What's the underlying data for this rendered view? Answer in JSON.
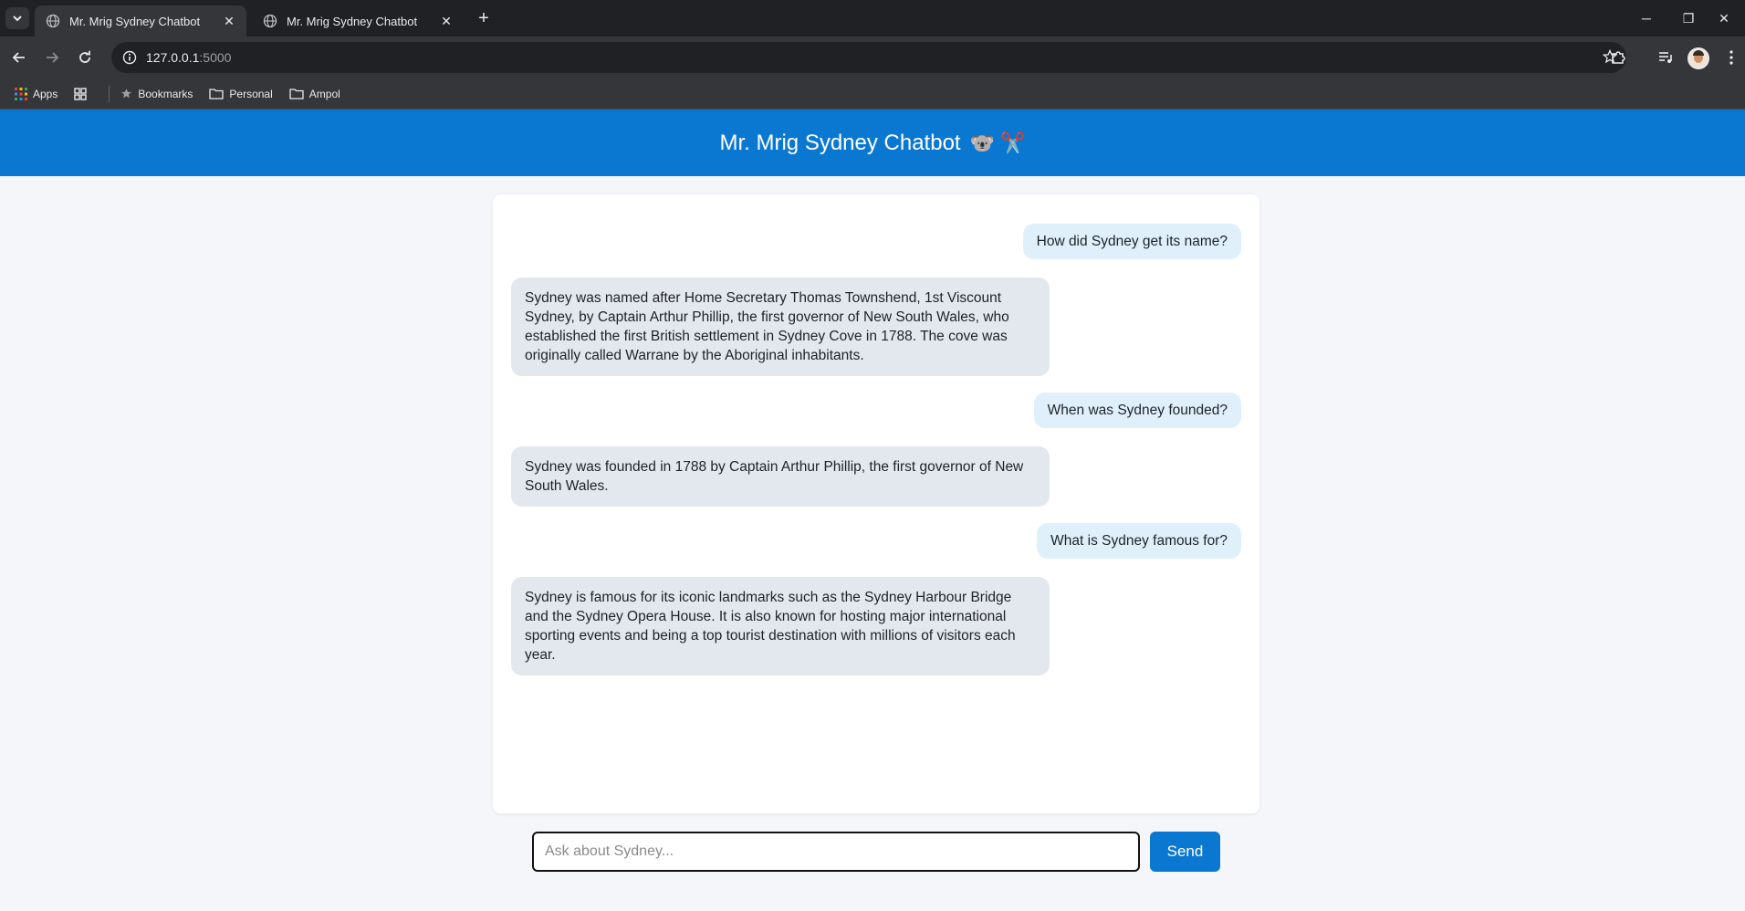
{
  "browser": {
    "tabs": [
      {
        "title": "Mr. Mrig Sydney Chatbot"
      },
      {
        "title": "Mr. Mrig Sydney Chatbot"
      }
    ],
    "url_host": "127.0.0.1",
    "url_port": ":5000",
    "bookmarks": [
      {
        "label": "Apps",
        "icon": "apps-grid-icon"
      },
      {
        "label": "Bookmarks",
        "icon": "star-icon"
      },
      {
        "label": "Personal",
        "icon": "folder-icon"
      },
      {
        "label": "Ampol",
        "icon": "folder-icon"
      }
    ]
  },
  "app": {
    "title": "Mr. Mrig Sydney Chatbot",
    "title_emojis": "🐨 ✂️",
    "colors": {
      "accent": "#0a77d1",
      "user_bubble": "#dff0fb",
      "bot_bubble": "#e3e7ee"
    }
  },
  "messages": [
    {
      "role": "user",
      "text": "How did Sydney get its name?"
    },
    {
      "role": "bot",
      "text": "Sydney was named after Home Secretary Thomas Townshend, 1st Viscount Sydney, by Captain Arthur Phillip, the first governor of New South Wales, who established the first British settlement in Sydney Cove in 1788. The cove was originally called Warrane by the Aboriginal inhabitants."
    },
    {
      "role": "user",
      "text": "When was Sydney founded?"
    },
    {
      "role": "bot",
      "text": "Sydney was founded in 1788 by Captain Arthur Phillip, the first governor of New South Wales."
    },
    {
      "role": "user",
      "text": "What is Sydney famous for?"
    },
    {
      "role": "bot",
      "text": "Sydney is famous for its iconic landmarks such as the Sydney Harbour Bridge and the Sydney Opera House. It is also known for hosting major international sporting events and being a top tourist destination with millions of visitors each year."
    }
  ],
  "input": {
    "placeholder": "Ask about Sydney...",
    "value": ""
  },
  "send_label": "Send"
}
